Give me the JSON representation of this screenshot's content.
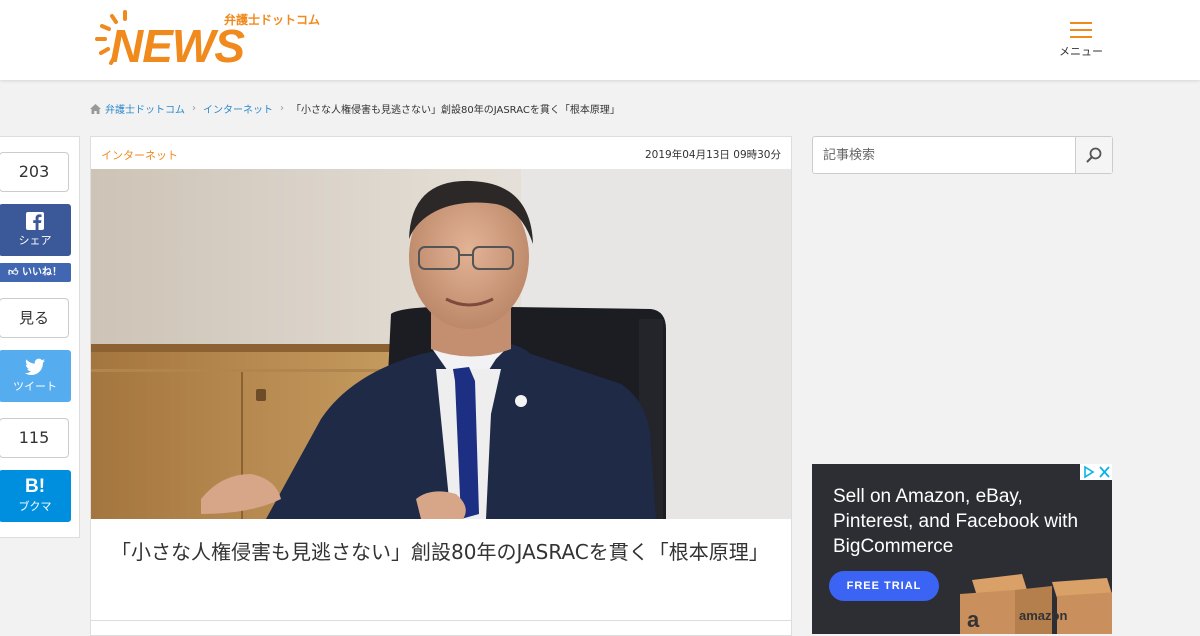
{
  "header": {
    "logo_small": "弁護士ドットコム",
    "logo_big": "NEWS",
    "menu_label": "メニュー"
  },
  "breadcrumb": {
    "home": "弁護士ドットコム",
    "category": "インターネット",
    "current": "「小さな人権侵害も見逃さない」創設80年のJASRACを貫く「根本原理」"
  },
  "share": {
    "facebook_count": "203",
    "facebook_label": "シェア",
    "like_label": "いいね！",
    "view_label": "見る",
    "twitter_label": "ツイート",
    "hatena_count": "115",
    "hatena_label": "ブクマ"
  },
  "article": {
    "category": "インターネット",
    "date": "2019年04月13日 09時30分",
    "headline": "「小さな人権侵害も見逃さない」創設80年のJASRACを貫く「根本原理」"
  },
  "sidebar": {
    "search_placeholder": "記事検索"
  },
  "ad": {
    "text": "Sell on Amazon, eBay, Pinterest, and Facebook with BigCommerce",
    "cta": "FREE TRIAL",
    "box_label": "amazon"
  },
  "colors": {
    "brand": "#f08a1c",
    "link": "#2a8acb",
    "facebook": "#3b5998",
    "twitter": "#55acee",
    "hatena": "#008fde"
  }
}
